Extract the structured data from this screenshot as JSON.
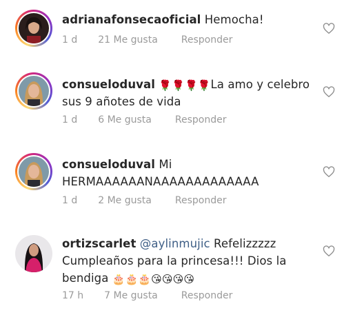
{
  "comments": [
    {
      "username": "adrianafonsecaoficial",
      "mention": "",
      "text": "Hemocha!",
      "time": "1 d",
      "likes": "21 Me gusta",
      "reply": "Responder"
    },
    {
      "username": "consueloduval",
      "mention": "",
      "emoji_lead": "🌹🌹🌹🌹",
      "text": "La amo y celebro sus 9 añotes de vida",
      "time": "1 d",
      "likes": "6 Me gusta",
      "reply": "Responder"
    },
    {
      "username": "consueloduval",
      "mention": "",
      "text": "Mi HERMAAAAAANAAAAAAAAAAAAA",
      "time": "1 d",
      "likes": "2 Me gusta",
      "reply": "Responder"
    },
    {
      "username": "ortizscarlet",
      "mention": "@aylinmujic",
      "text": "Refelizzzzz Cumpleaños para la princesa!!! Dios la bendiga",
      "emoji_trail": "🎂🎂🎂😘😘😘😘",
      "time": "17 h",
      "likes": "7 Me gusta",
      "reply": "Responder"
    }
  ],
  "icons": {
    "like": "heart-outline-icon"
  },
  "colors": {
    "text": "#262626",
    "meta": "#9a9a9a",
    "mention": "#3f5f86",
    "story_ring": "#d62976"
  }
}
